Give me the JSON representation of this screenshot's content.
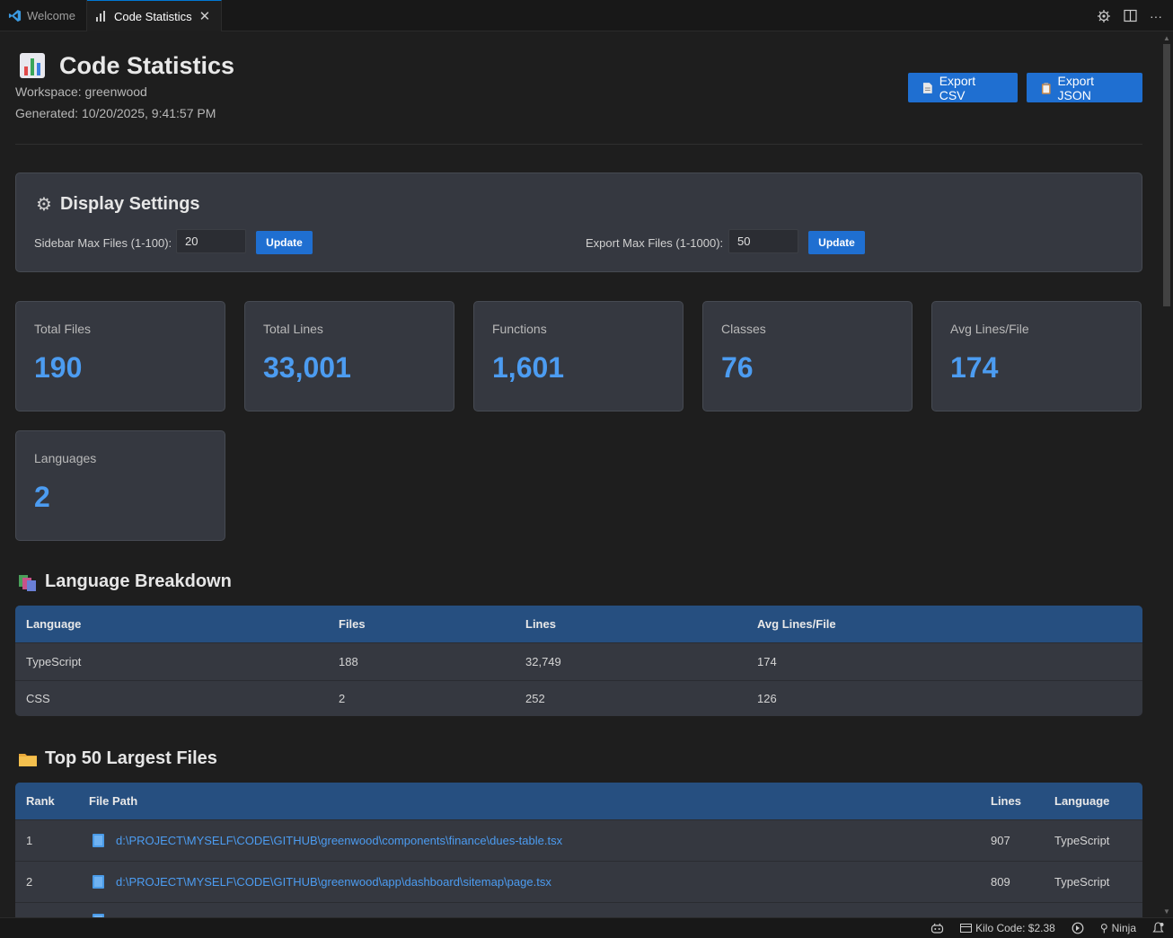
{
  "tabs": [
    {
      "label": "Welcome",
      "icon": "vscode-logo-icon",
      "active": false
    },
    {
      "label": "Code Statistics",
      "icon": "bar-chart-icon",
      "active": true
    }
  ],
  "header": {
    "title": "Code Statistics",
    "workspace": "Workspace: greenwood",
    "generated": "Generated: 10/20/2025, 9:41:57 PM",
    "export_csv": "Export CSV",
    "export_json": "Export JSON"
  },
  "settings": {
    "title": "Display Settings",
    "sidebar_label": "Sidebar Max Files (1-100):",
    "sidebar_value": "20",
    "export_label": "Export Max Files (1-1000):",
    "export_value": "50",
    "update_label": "Update"
  },
  "stats": [
    {
      "label": "Total Files",
      "value": "190"
    },
    {
      "label": "Total Lines",
      "value": "33,001"
    },
    {
      "label": "Functions",
      "value": "1,601"
    },
    {
      "label": "Classes",
      "value": "76"
    },
    {
      "label": "Avg Lines/File",
      "value": "174"
    },
    {
      "label": "Languages",
      "value": "2"
    }
  ],
  "language_breakdown": {
    "title": "Language Breakdown",
    "columns": [
      "Language",
      "Files",
      "Lines",
      "Avg Lines/File"
    ],
    "rows": [
      [
        "TypeScript",
        "188",
        "32,749",
        "174"
      ],
      [
        "CSS",
        "2",
        "252",
        "126"
      ]
    ]
  },
  "largest_files": {
    "title": "Top 50 Largest Files",
    "columns": [
      "Rank",
      "File Path",
      "Lines",
      "Language"
    ],
    "rows": [
      [
        "1",
        "d:\\PROJECT\\MYSELF\\CODE\\GITHUB\\greenwood\\components\\finance\\dues-table.tsx",
        "907",
        "TypeScript"
      ],
      [
        "2",
        "d:\\PROJECT\\MYSELF\\CODE\\GITHUB\\greenwood\\app\\dashboard\\sitemap\\page.tsx",
        "809",
        "TypeScript"
      ]
    ]
  },
  "statusbar": {
    "kilo": "Kilo Code: $2.38",
    "ninja": "Ninja"
  },
  "colors": {
    "accent": "#1f6fd1",
    "stat_value": "#4c9cf1",
    "table_header": "#264f80",
    "card_bg": "#353840"
  }
}
